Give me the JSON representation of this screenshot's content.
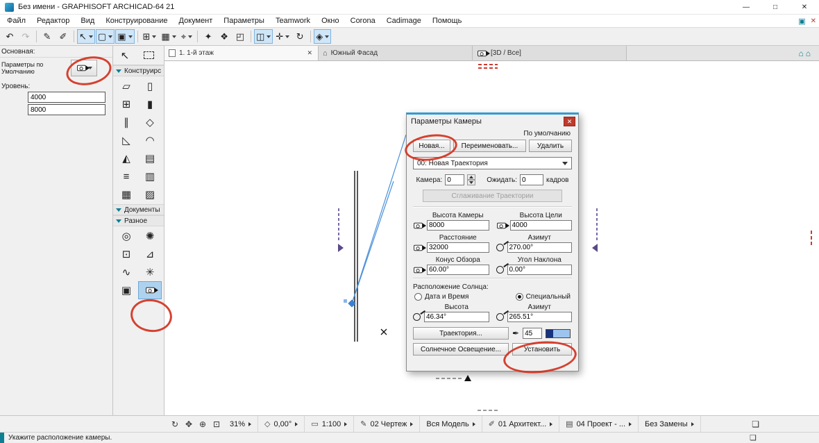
{
  "window": {
    "title": "Без имени - GRAPHISOFT ARCHICAD-64 21",
    "minimize": "—",
    "maximize": "□",
    "close": "✕"
  },
  "menu": {
    "items": [
      "Файл",
      "Редактор",
      "Вид",
      "Конструирование",
      "Документ",
      "Параметры",
      "Teamwork",
      "Окно",
      "Corona",
      "Cadimage",
      "Помощь"
    ],
    "panel_glyph": "▣",
    "close_glyph": "✕"
  },
  "toolbar": {
    "icons": [
      {
        "name": "undo",
        "glyph": "↶"
      },
      {
        "name": "redo",
        "glyph": "↷"
      },
      {
        "name": "pick-up-parameters",
        "glyph": "✎"
      },
      {
        "name": "inject-parameters",
        "glyph": "✐"
      },
      {
        "name": "arrow-tool",
        "glyph": "↖"
      },
      {
        "name": "marquee-tool",
        "glyph": "▢"
      },
      {
        "name": "favorites",
        "glyph": "▣"
      },
      {
        "name": "grid-snap",
        "glyph": "⊞"
      },
      {
        "name": "guide-lines",
        "glyph": "▦"
      },
      {
        "name": "gravity",
        "glyph": "⌖"
      },
      {
        "name": "magic-wand",
        "glyph": "✦"
      },
      {
        "name": "groups",
        "glyph": "❖"
      },
      {
        "name": "suspend-groups",
        "glyph": "◰"
      },
      {
        "name": "trace-reference",
        "glyph": "◫"
      },
      {
        "name": "move",
        "glyph": "✛"
      },
      {
        "name": "rotate",
        "glyph": "↻"
      },
      {
        "name": "3d-visualization",
        "glyph": "◈"
      }
    ]
  },
  "tabs": {
    "items": [
      {
        "label": "1. 1-й этаж"
      },
      {
        "label": "Южный Фасад"
      },
      {
        "label": "[3D / Все]"
      }
    ],
    "close_glyph": "✕",
    "right_icon1": "⌂",
    "right_icon2": "⌂"
  },
  "info_panel": {
    "section_label": "Основная:",
    "defaults_label": "Параметры по Умолчанию",
    "level_label": "Уровень:",
    "level1": "4000",
    "level2": "8000"
  },
  "toolbox": {
    "header_arrow_glyph": "↖",
    "construct_label": "Конструирс",
    "documents_label": "Документы",
    "misc_label": "Разное",
    "tools": [
      {
        "name": "wall-tool",
        "glyph": "▱"
      },
      {
        "name": "door-tool",
        "glyph": "▯"
      },
      {
        "name": "slab-tool",
        "glyph": "⊞"
      },
      {
        "name": "column-tool",
        "glyph": "▮"
      },
      {
        "name": "beam-tool",
        "glyph": "∥"
      },
      {
        "name": "window-tool",
        "glyph": "◇"
      },
      {
        "name": "roof-tool",
        "glyph": "◺"
      },
      {
        "name": "shell-tool",
        "glyph": "◠"
      },
      {
        "name": "morph-tool",
        "glyph": "◭"
      },
      {
        "name": "curtain-wall-tool",
        "glyph": "▤"
      },
      {
        "name": "stair-tool",
        "glyph": "≡"
      },
      {
        "name": "railing-tool",
        "glyph": "▥"
      },
      {
        "name": "mesh-tool",
        "glyph": "▦"
      },
      {
        "name": "zone-tool",
        "glyph": "▨"
      }
    ],
    "misc_tools": [
      {
        "name": "hotspot-tool",
        "glyph": "◎"
      },
      {
        "name": "lamp-tool",
        "glyph": "✺"
      },
      {
        "name": "grid-element-tool",
        "glyph": "⊡"
      },
      {
        "name": "level-dimension-tool",
        "glyph": "⊿"
      },
      {
        "name": "spline-tool",
        "glyph": "∿"
      },
      {
        "name": "sun-object-tool",
        "glyph": "✳"
      },
      {
        "name": "figure-tool",
        "glyph": "▣"
      }
    ]
  },
  "dialog": {
    "title": "Параметры Камеры",
    "close_glyph": "✕",
    "default_label": "По умолчанию",
    "new_btn": "Новая...",
    "rename_btn": "Переименовать...",
    "delete_btn": "Удалить",
    "path_value": "00: Новая Траектория",
    "camera_label": "Камера:",
    "camera_value": "0",
    "wait_label": "Ожидать:",
    "wait_value": "0",
    "frames_label": "кадров",
    "smooth_btn": "Сглаживание Траектории",
    "camera_height_label": "Высота Камеры",
    "camera_height": "8000",
    "target_height_label": "Высота Цели",
    "target_height": "4000",
    "distance_label": "Расстояние",
    "distance": "32000",
    "azimuth_label": "Азимут",
    "azimuth": "270.00°",
    "cone_label": "Конус Обзора",
    "cone": "60.00°",
    "tilt_label": "Угол Наклона",
    "tilt": "0.00°",
    "sun_section_label": "Расположение Солнца:",
    "radio_datetime": "Дата и Время",
    "radio_custom": "Специальный",
    "sun_alt_label": "Высота",
    "sun_alt": "46.34°",
    "sun_az_label": "Азимут",
    "sun_az": "265.51°",
    "path_btn": "Траектория...",
    "pen_glyph": "✒",
    "pen_value": "45",
    "sun_btn": "Солнечное Освещение...",
    "apply_btn": "Установить"
  },
  "bottom_bar": {
    "nav_icons": [
      {
        "name": "zoom-to-fit",
        "glyph": "↻"
      },
      {
        "name": "pan",
        "glyph": "✥"
      },
      {
        "name": "zoom-in",
        "glyph": "⊕"
      },
      {
        "name": "zoom-window",
        "glyph": "⊡"
      }
    ],
    "zoom": "31%",
    "angle_icon": "◇",
    "angle": "0,00°",
    "scale_icon": "▭",
    "scale": "1:100",
    "pen_set_icon": "✎",
    "pen_set": "02 Чертеж",
    "model_filter": "Вся Модель",
    "layer_icon": "✐",
    "layer_combo": "01 Архитект...",
    "fav_icon": "▤",
    "favorites": "04 Проект - ...",
    "overrides": "Без Замены",
    "window_icon": "❏"
  },
  "status": {
    "hint": "Укажите расположение камеры.",
    "copy_icon": "❏"
  }
}
